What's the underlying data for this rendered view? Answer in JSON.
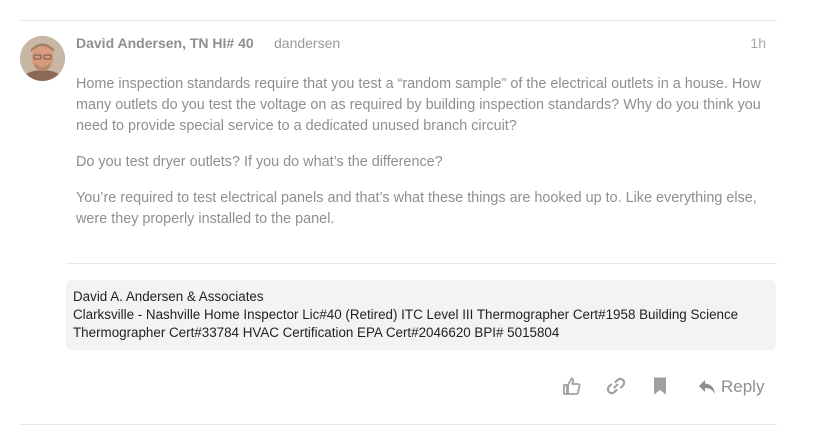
{
  "post": {
    "author_full_name": "David Andersen, TN HI# 40",
    "author_username": "dandersen",
    "date": "1h",
    "avatar_icon": "user-avatar-photo",
    "paragraphs": [
      "Home inspection standards require that you test a “random sample” of the electrical outlets in a house. How many outlets do you test the voltage on as required by building inspection standards? Why do you think you need to provide special service to a dedicated unused branch circuit?",
      "Do you test dryer outlets? If you do what’s the difference?",
      "You’re required to test electrical panels and that’s what these things are hooked up to. Like everything else, were they properly installed to the panel."
    ]
  },
  "signature": {
    "line1": "David A. Andersen & Associates",
    "line2": "Clarksville - Nashville Home Inspector Lic#40 (Retired) ITC Level III Thermographer Cert#1958 Building Science",
    "line3": "Thermographer Cert#33784 HVAC Certification EPA Cert#2046620 BPI# 5015804"
  },
  "actions": {
    "like_icon": "thumbs-up-icon",
    "link_icon": "link-icon",
    "bookmark_icon": "bookmark-icon",
    "reply_icon": "reply-arrow-icon",
    "reply_label": "Reply"
  },
  "colors": {
    "text_muted": "#8f8f8f",
    "icon": "#a0a0a0",
    "signature_bg": "#f2f3f5",
    "divider": "#e9e9e9"
  }
}
